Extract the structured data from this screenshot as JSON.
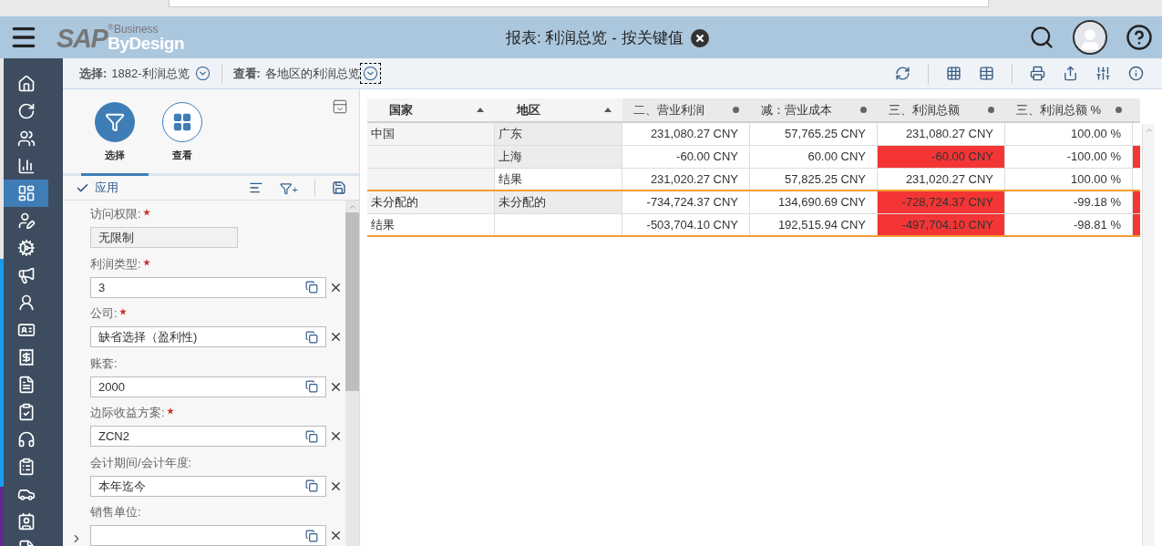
{
  "logo": {
    "brand": "SAP",
    "mark": "®",
    "line1": "Business",
    "line2": "ByDesign"
  },
  "window": {
    "title": "报表: 利润总览 - 按关键值"
  },
  "nav": [
    {
      "selected": false
    },
    {
      "selected": false
    },
    {
      "selected": false
    },
    {
      "selected": false
    },
    {
      "selected": true
    },
    {
      "selected": false
    },
    {
      "selected": false
    },
    {
      "selected": false
    },
    {
      "selected": false
    },
    {
      "selected": false
    },
    {
      "selected": false
    },
    {
      "selected": false
    },
    {
      "selected": false
    },
    {
      "selected": false
    },
    {
      "selected": false
    },
    {
      "selected": false
    },
    {
      "selected": false
    },
    {
      "selected": false
    }
  ],
  "toolbar": {
    "selection_label": "选择:",
    "selection_value": "1882-利润总览",
    "view_label": "查看:",
    "view_value": "各地区的利润总览"
  },
  "panel_tabs": [
    {
      "label": "选择",
      "selected": true
    },
    {
      "label": "查看",
      "selected": false
    }
  ],
  "apply": {
    "label": "应用"
  },
  "add_filter_mark": "+",
  "fields": [
    {
      "label": "访问权限:",
      "required": true,
      "kind": "readonly",
      "value": "无限制"
    },
    {
      "label": "利润类型:",
      "required": true,
      "kind": "lookup",
      "value": "3"
    },
    {
      "label": "公司:",
      "required": true,
      "kind": "lookup",
      "value": "缺省选择（盈利性)"
    },
    {
      "label": "账套:",
      "required": false,
      "kind": "lookup",
      "value": "2000"
    },
    {
      "label": "边际收益方案:",
      "required": true,
      "kind": "lookup",
      "value": "ZCN2"
    },
    {
      "label": "会计期间/会计年度:",
      "required": false,
      "kind": "lookup",
      "value": "本年迄今"
    },
    {
      "label": "销售单位:",
      "required": false,
      "kind": "lookup"
    }
  ],
  "table": {
    "columns": [
      {
        "label": "国家",
        "kind": "sort"
      },
      {
        "label": "地区",
        "kind": "sort"
      },
      {
        "label": "二、营业利润",
        "kind": "measure"
      },
      {
        "label": "减：营业成本",
        "kind": "measure"
      },
      {
        "label": "三、利润总额",
        "kind": "measure"
      },
      {
        "label": "三、利润总额 %",
        "kind": "measure"
      }
    ],
    "rows": [
      {
        "kind": "detail",
        "cells": [
          {
            "text": "中国",
            "highlight": false
          },
          {
            "text": "广东",
            "highlight": false
          },
          {
            "text": "231,080.27 CNY",
            "highlight": false
          },
          {
            "text": "57,765.25 CNY",
            "highlight": false
          },
          {
            "text": "231,080.27 CNY",
            "highlight": false
          },
          {
            "text": "100.00 %",
            "highlight": false
          }
        ],
        "edge_highlight": false
      },
      {
        "kind": "detail",
        "cells": [
          {
            "text": "",
            "highlight": false
          },
          {
            "text": "上海",
            "highlight": false
          },
          {
            "text": "-60.00 CNY",
            "highlight": false
          },
          {
            "text": "60.00 CNY",
            "highlight": false
          },
          {
            "text": "-60.00 CNY",
            "highlight": true
          },
          {
            "text": "-100.00 %",
            "highlight": false
          }
        ],
        "edge_highlight": true
      },
      {
        "kind": "subtotal",
        "cells": [
          {
            "text": "",
            "highlight": false
          },
          {
            "text": "结果",
            "highlight": false
          },
          {
            "text": "231,020.27 CNY",
            "highlight": false
          },
          {
            "text": "57,825.25 CNY",
            "highlight": false
          },
          {
            "text": "231,020.27 CNY",
            "highlight": false
          },
          {
            "text": "100.00 %",
            "highlight": false
          }
        ],
        "edge_highlight": false
      },
      {
        "kind": "detail",
        "cells": [
          {
            "text": "未分配的",
            "highlight": false
          },
          {
            "text": "未分配的",
            "highlight": false
          },
          {
            "text": "-734,724.37 CNY",
            "highlight": false
          },
          {
            "text": "134,690.69 CNY",
            "highlight": false
          },
          {
            "text": "-728,724.37 CNY",
            "highlight": true
          },
          {
            "text": "-99.18 %",
            "highlight": false
          }
        ],
        "edge_highlight": true
      },
      {
        "kind": "total",
        "cells": [
          {
            "text": "结果",
            "highlight": false
          },
          {
            "text": "",
            "highlight": false
          },
          {
            "text": "-503,704.10 CNY",
            "highlight": false
          },
          {
            "text": "192,515.94 CNY",
            "highlight": false
          },
          {
            "text": "-497,704.10 CNY",
            "highlight": true
          },
          {
            "text": "-98.81 %",
            "highlight": false
          }
        ],
        "edge_highlight": true
      }
    ]
  }
}
